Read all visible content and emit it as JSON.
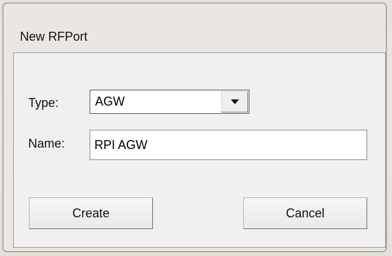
{
  "dialog": {
    "title": "New RFPort",
    "type_label": "Type:",
    "type_value": "AGW",
    "name_label": "Name:",
    "name_value": "RPI AGW",
    "create_label": "Create",
    "cancel_label": "Cancel"
  },
  "icons": {
    "dropdown": "chevron-down-icon"
  }
}
